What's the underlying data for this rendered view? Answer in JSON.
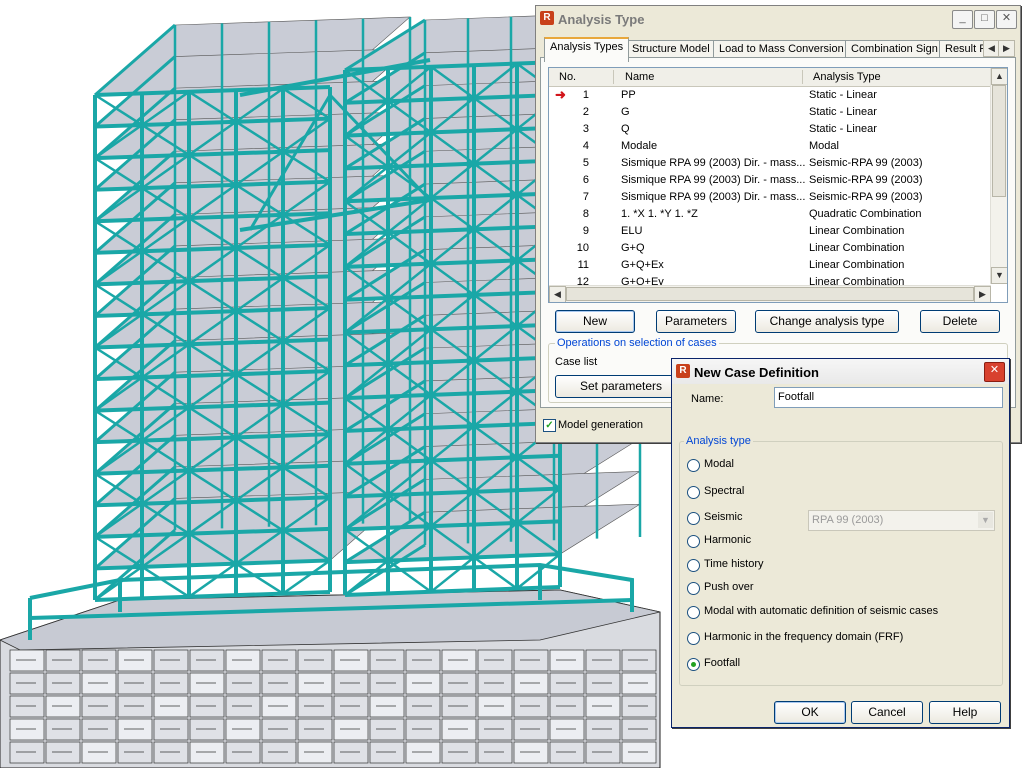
{
  "analysis_dialog": {
    "title": "Analysis Type",
    "tabs": [
      "Analysis Types",
      "Structure Model",
      "Load to Mass Conversion",
      "Combination Sign",
      "Result F"
    ],
    "columns": {
      "no": "No.",
      "name": "Name",
      "type": "Analysis Type"
    },
    "rows": [
      {
        "no": "1",
        "name": "PP",
        "type": "Static - Linear"
      },
      {
        "no": "2",
        "name": "G",
        "type": "Static - Linear"
      },
      {
        "no": "3",
        "name": "Q",
        "type": "Static - Linear"
      },
      {
        "no": "4",
        "name": "Modale",
        "type": "Modal"
      },
      {
        "no": "5",
        "name": "Sismique RPA 99 (2003) Dir. - mass...",
        "type": "Seismic-RPA 99 (2003)"
      },
      {
        "no": "6",
        "name": "Sismique RPA 99 (2003) Dir. - mass...",
        "type": "Seismic-RPA 99 (2003)"
      },
      {
        "no": "7",
        "name": "Sismique RPA 99 (2003) Dir. - mass...",
        "type": "Seismic-RPA 99 (2003)"
      },
      {
        "no": "8",
        "name": "1. *X 1. *Y 1. *Z",
        "type": "Quadratic Combination"
      },
      {
        "no": "9",
        "name": "ELU",
        "type": "Linear Combination"
      },
      {
        "no": "10",
        "name": "G+Q",
        "type": "Linear Combination"
      },
      {
        "no": "11",
        "name": "G+Q+Ex",
        "type": "Linear Combination"
      },
      {
        "no": "12",
        "name": "G+Q+Ey",
        "type": "Linear Combination"
      }
    ],
    "buttons": {
      "new": "New",
      "parameters": "Parameters",
      "change": "Change analysis type",
      "delete": "Delete"
    },
    "operations_title": "Operations on selection of cases",
    "case_list_label": "Case list",
    "set_parameters": "Set parameters",
    "model_generation": "Model generation"
  },
  "new_case_dialog": {
    "title": "New Case Definition",
    "name_label": "Name:",
    "name_value": "Footfall",
    "group_title": "Analysis type",
    "options": [
      "Modal",
      "Spectral",
      "Seismic",
      "Harmonic",
      "Time history",
      "Push over",
      "Modal with automatic definition of seismic cases",
      "Harmonic in the frequency domain (FRF)",
      "Footfall"
    ],
    "selected_option": "Footfall",
    "seismic_code": "RPA 99 (2003)",
    "buttons": {
      "ok": "OK",
      "cancel": "Cancel",
      "help": "Help"
    }
  },
  "colors": {
    "structure": "#1aa7a7",
    "slab": "#c9ccd6",
    "selection_arrow": "#d2141a",
    "accent": "#0046d5"
  },
  "icons": {
    "app": "robot-app-icon",
    "close": "close-icon",
    "minimize": "minimize-icon",
    "maximize": "maximize-icon",
    "arrow": "current-case-arrow-icon"
  }
}
